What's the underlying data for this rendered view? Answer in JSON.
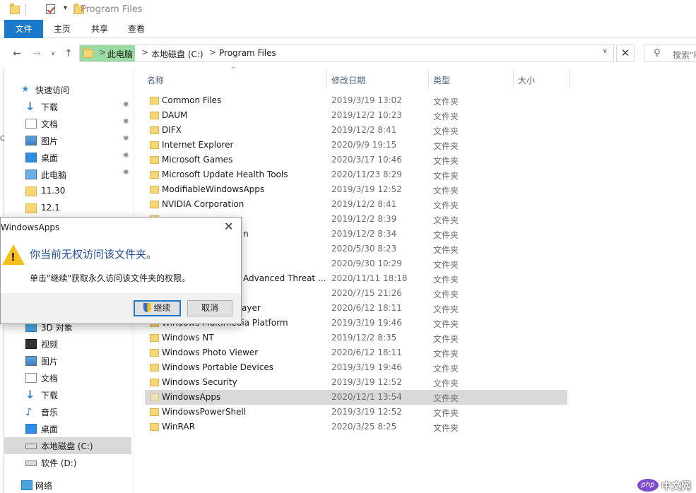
{
  "window": {
    "title": "Program Files"
  },
  "ribbon": {
    "tabs": [
      "文件",
      "主页",
      "共享",
      "查看"
    ],
    "active_tab": "文件"
  },
  "address": {
    "crumbs": [
      "此电脑",
      "本地磁盘 (C:)",
      "Program Files"
    ],
    "separator": ">"
  },
  "search": {
    "placeholder": "搜索\"P"
  },
  "sidebar": {
    "items": [
      {
        "label": "快速访问",
        "icon": "star-icon"
      },
      {
        "label": "下载",
        "icon": "download-icon",
        "pinned": true
      },
      {
        "label": "文档",
        "icon": "document-icon",
        "pinned": true
      },
      {
        "label": "图片",
        "icon": "pictures-icon",
        "pinned": true
      },
      {
        "label": "桌面",
        "icon": "desktop-icon",
        "pinned": true
      },
      {
        "label": "此电脑",
        "icon": "computer-icon",
        "pinned": true
      },
      {
        "label": "11.30",
        "icon": "folder-icon"
      },
      {
        "label": "12.1",
        "icon": "folder-icon"
      },
      {
        "label": "3D 对象",
        "icon": "3d-objects-icon"
      },
      {
        "label": "视频",
        "icon": "video-icon"
      },
      {
        "label": "图片",
        "icon": "pictures-icon"
      },
      {
        "label": "文档",
        "icon": "document-icon"
      },
      {
        "label": "下载",
        "icon": "download-icon"
      },
      {
        "label": "音乐",
        "icon": "music-icon"
      },
      {
        "label": "桌面",
        "icon": "desktop-icon"
      },
      {
        "label": "本地磁盘 (C:)",
        "icon": "drive-icon",
        "selected": true
      },
      {
        "label": "软件 (D:)",
        "icon": "drive-icon"
      },
      {
        "label": "网络",
        "icon": "network-icon"
      }
    ],
    "pin_glyph": "📌"
  },
  "columns": {
    "name": "名称",
    "date": "修改日期",
    "type": "类型",
    "size": "大小"
  },
  "files": [
    {
      "name": "Common Files",
      "date": "2019/3/19 13:02",
      "type": "文件夹"
    },
    {
      "name": "DAUM",
      "date": "2019/12/2 10:23",
      "type": "文件夹"
    },
    {
      "name": "DIFX",
      "date": "2019/12/2 8:41",
      "type": "文件夹"
    },
    {
      "name": "Internet Explorer",
      "date": "2020/9/9 19:15",
      "type": "文件夹"
    },
    {
      "name": "Microsoft Games",
      "date": "2020/3/17 10:46",
      "type": "文件夹"
    },
    {
      "name": "Microsoft Update Health Tools",
      "date": "2020/11/23 8:29",
      "type": "文件夹"
    },
    {
      "name": "ModifiableWindowsApps",
      "date": "2019/3/19 12:52",
      "type": "文件夹"
    },
    {
      "name": "NVIDIA Corporation",
      "date": "2019/12/2 8:41",
      "type": "文件夹"
    },
    {
      "name": "",
      "date": "2019/12/2 8:39",
      "type": "文件夹"
    },
    {
      "name": "n",
      "date": "2019/12/2 8:34",
      "type": "文件夹"
    },
    {
      "name": "",
      "date": "2020/5/30 8:23",
      "type": "文件夹"
    },
    {
      "name": "",
      "date": "2020/9/30 10:29",
      "type": "文件夹"
    },
    {
      "name": "Advanced Threat ...",
      "date": "2020/11/11 18:18",
      "type": "文件夹"
    },
    {
      "name": "",
      "date": "2020/7/15 21:26",
      "type": "文件夹"
    },
    {
      "name": "ayer",
      "date": "2020/6/12 18:11",
      "type": "文件夹"
    },
    {
      "name": "Windows Multimedia Platform",
      "date": "2019/3/19 19:46",
      "type": "文件夹"
    },
    {
      "name": "Windows NT",
      "date": "2019/12/2 8:35",
      "type": "文件夹"
    },
    {
      "name": "Windows Photo Viewer",
      "date": "2020/6/12 18:11",
      "type": "文件夹"
    },
    {
      "name": "Windows Portable Devices",
      "date": "2019/3/19 19:46",
      "type": "文件夹"
    },
    {
      "name": "Windows Security",
      "date": "2019/3/19 12:52",
      "type": "文件夹"
    },
    {
      "name": "WindowsApps",
      "date": "2020/12/1 13:54",
      "type": "文件夹",
      "selected": true
    },
    {
      "name": "WindowsPowerShell",
      "date": "2019/3/19 12:52",
      "type": "文件夹"
    },
    {
      "name": "WinRAR",
      "date": "2020/3/25 8:25",
      "type": "文件夹"
    }
  ],
  "dialog": {
    "title": "WindowsApps",
    "message": "你当前无权访问该文件夹。",
    "detail": "单击\"继续\"获取永久访问该文件夹的权限。",
    "continue_label": "继续",
    "cancel_label": "取消"
  },
  "watermark": {
    "logo": "php",
    "text": "中文网"
  },
  "colors": {
    "accent": "#1979ca",
    "selection": "#d9d9d9",
    "folder": "#f7d673",
    "dialog_heading": "#1f4e9c"
  }
}
